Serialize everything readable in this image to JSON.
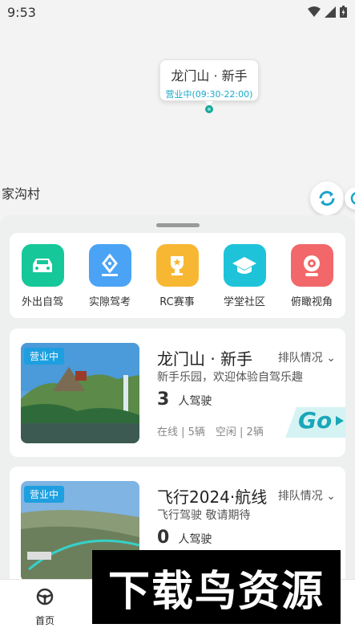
{
  "status": {
    "time": "9:53"
  },
  "map": {
    "marker_title": "龙门山 · 新手",
    "marker_hours": "营业中(09:30-22:00)",
    "place_label": "家沟村"
  },
  "quick_actions": [
    {
      "label": "外出自驾",
      "icon": "car-icon",
      "color": "#16c79a"
    },
    {
      "label": "实隙驾考",
      "icon": "pen-badge-icon",
      "color": "#4ba3f5"
    },
    {
      "label": "RC赛事",
      "icon": "trophy-icon",
      "color": "#f7b733"
    },
    {
      "label": "学堂社区",
      "icon": "graduation-cap-icon",
      "color": "#1ec3d9"
    },
    {
      "label": "俯瞰视角",
      "icon": "webcam-icon",
      "color": "#f2686a"
    }
  ],
  "routes": [
    {
      "badge": "营业中",
      "title": "龙门山 · 新手",
      "queue": "排队情况",
      "desc": "新手乐园，欢迎体验自驾乐趣",
      "drivers": "3",
      "drivers_unit": "人驾驶",
      "stats": "在线 | 5辆　空闲 | 2辆",
      "go": "Go"
    },
    {
      "badge": "营业中",
      "title": "飞行2024·航线",
      "queue": "排队情况",
      "desc": "飞行驾驶 敬请期待",
      "drivers": "0",
      "drivers_unit": "人驾驶"
    }
  ],
  "nav": {
    "home_label": "首页"
  },
  "watermark": "下载鸟资源",
  "colors": {
    "accent": "#1e9fe0",
    "teal": "#19a9c9",
    "go": "#1aa7b8"
  }
}
